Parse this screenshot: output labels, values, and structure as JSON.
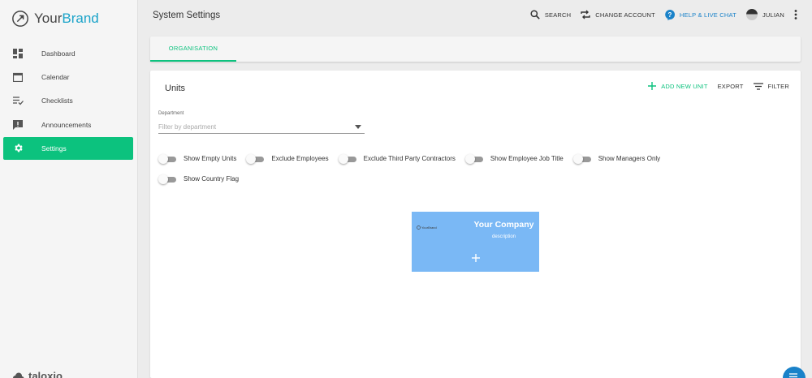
{
  "brand": {
    "name_prefix": "Your",
    "name_suffix": "Brand"
  },
  "sidebar": {
    "items": [
      {
        "label": "Dashboard",
        "icon": "dashboard-icon"
      },
      {
        "label": "Calendar",
        "icon": "calendar-icon"
      },
      {
        "label": "Checklists",
        "icon": "checklist-icon"
      },
      {
        "label": "Announcements",
        "icon": "announcement-icon"
      },
      {
        "label": "Settings",
        "icon": "gear-icon",
        "active": true
      }
    ],
    "footer_brand": "taloxio"
  },
  "header": {
    "title": "System Settings",
    "search_label": "SEARCH",
    "change_account_label": "CHANGE ACCOUNT",
    "help_label": "HELP & LIVE CHAT",
    "user_name": "JULIAN"
  },
  "tabs": [
    {
      "label": "ORGANISATION",
      "active": true
    }
  ],
  "units": {
    "title": "Units",
    "add_label": "ADD NEW UNIT",
    "export_label": "EXPORT",
    "filter_label": "FILTER",
    "department": {
      "label": "Department",
      "placeholder": "Filter by department"
    },
    "toggles": [
      {
        "label": "Show Empty Units",
        "on": false
      },
      {
        "label": "Exclude Employees",
        "on": false
      },
      {
        "label": "Exclude Third Party Contractors",
        "on": false
      },
      {
        "label": "Show Employee Job Title",
        "on": false
      },
      {
        "label": "Show Managers Only",
        "on": false
      },
      {
        "label": "Show Country Flag",
        "on": false
      }
    ],
    "org_node": {
      "logo_text": "YourBrand",
      "name": "Your Company",
      "description": "description"
    }
  },
  "colors": {
    "accent": "#0cc27e",
    "help": "#1a82c9",
    "node": "#7ab8f5"
  }
}
